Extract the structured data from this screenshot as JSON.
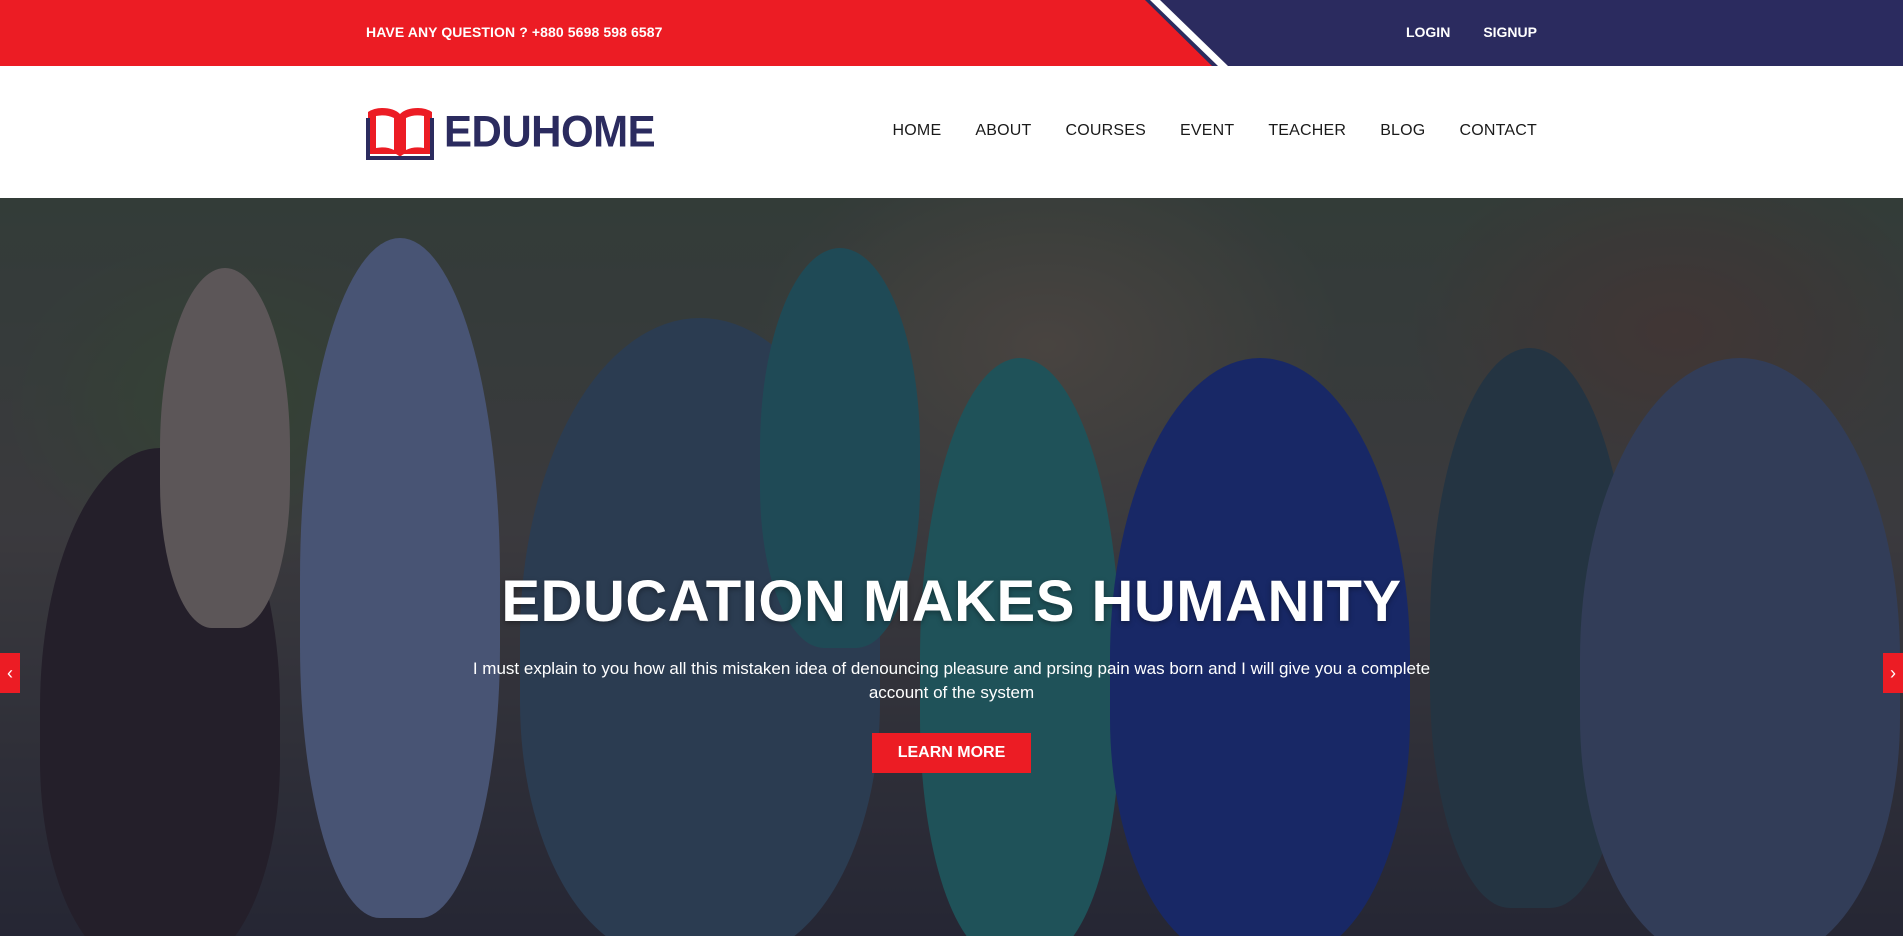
{
  "topbar": {
    "question": "HAVE ANY QUESTION ? +880 5698 598 6587",
    "login": "LOGIN",
    "signup": "SIGNUP"
  },
  "logo": {
    "text": "EDUHOME",
    "icon": "open-book-icon"
  },
  "nav": {
    "items": [
      "HOME",
      "ABOUT",
      "COURSES",
      "EVENT",
      "TEACHER",
      "BLOG",
      "CONTACT"
    ]
  },
  "hero": {
    "title": "EDUCATION MAKES HUMANITY",
    "subtitle": "I must explain to you how all this mistaken idea of denouncing pleasure and prsing pain was born and I will give you a complete account of the system",
    "button": "LEARN MORE",
    "prev_icon": "chevron-left-icon",
    "next_icon": "chevron-right-icon",
    "prev_glyph": "‹",
    "next_glyph": "›"
  },
  "colors": {
    "primary_red": "#ec1c24",
    "navy": "#2b2b5f",
    "white": "#ffffff"
  }
}
